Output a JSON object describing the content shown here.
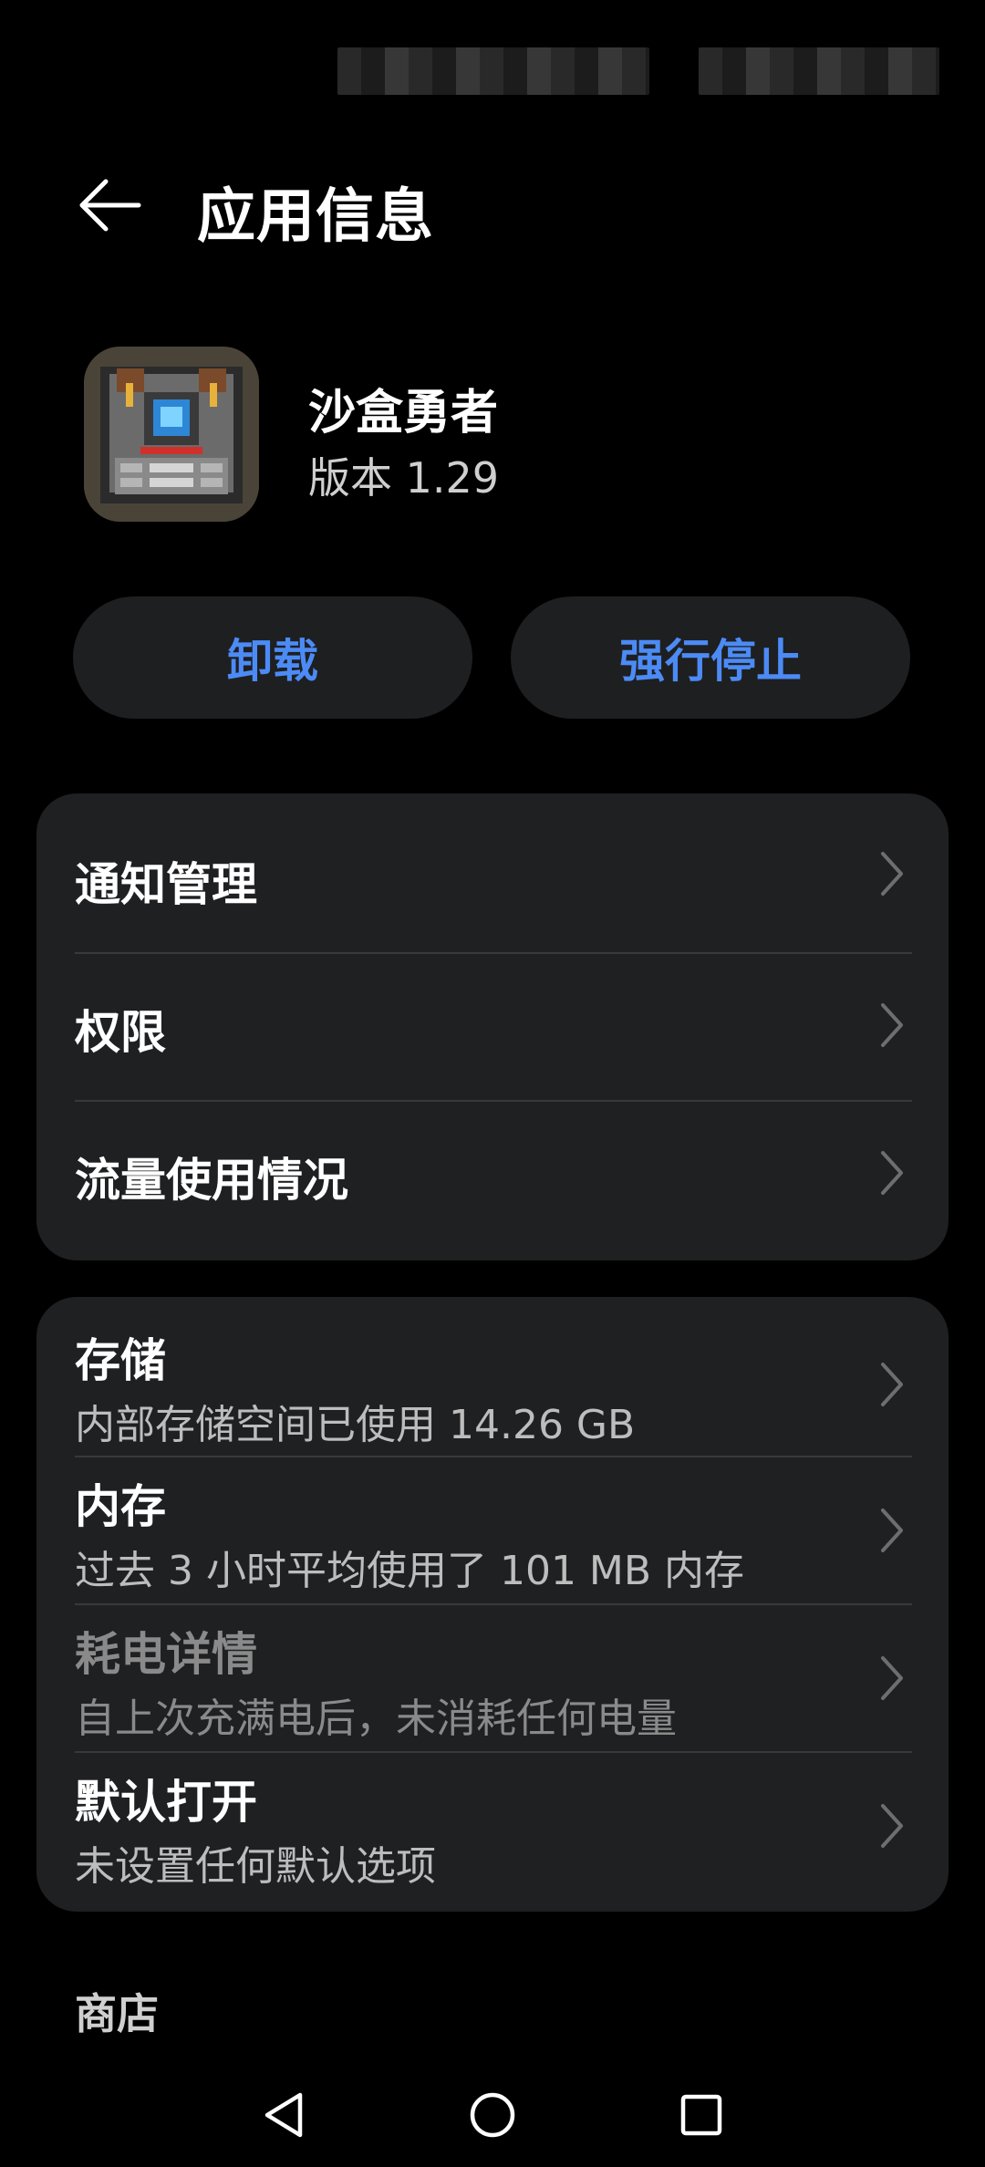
{
  "header": {
    "title": "应用信息"
  },
  "app": {
    "name": "沙盒勇者",
    "version": "版本 1.29"
  },
  "actions": {
    "uninstall_label": "卸载",
    "force_stop_label": "强行停止"
  },
  "settings_group_1": {
    "items": [
      {
        "label": "通知管理"
      },
      {
        "label": "权限"
      },
      {
        "label": "流量使用情况"
      }
    ]
  },
  "settings_group_2": {
    "items": [
      {
        "label": "存储",
        "detail": "内部存储空间已使用 14.26 GB"
      },
      {
        "label": "内存",
        "detail": "过去 3 小时平均使用了 101 MB 内存"
      },
      {
        "label": "耗电详情",
        "detail": "自上次充满电后，未消耗任何电量"
      },
      {
        "label": "默认打开",
        "detail": "未设置任何默认选项"
      }
    ]
  },
  "store_section": {
    "label": "商店"
  },
  "colors": {
    "background": "#000000",
    "card": "#1f2022",
    "accent": "#4c8bf5",
    "text_primary": "#ffffff",
    "text_secondary": "#bdbdbd",
    "text_disabled": "#8a8a8a"
  }
}
